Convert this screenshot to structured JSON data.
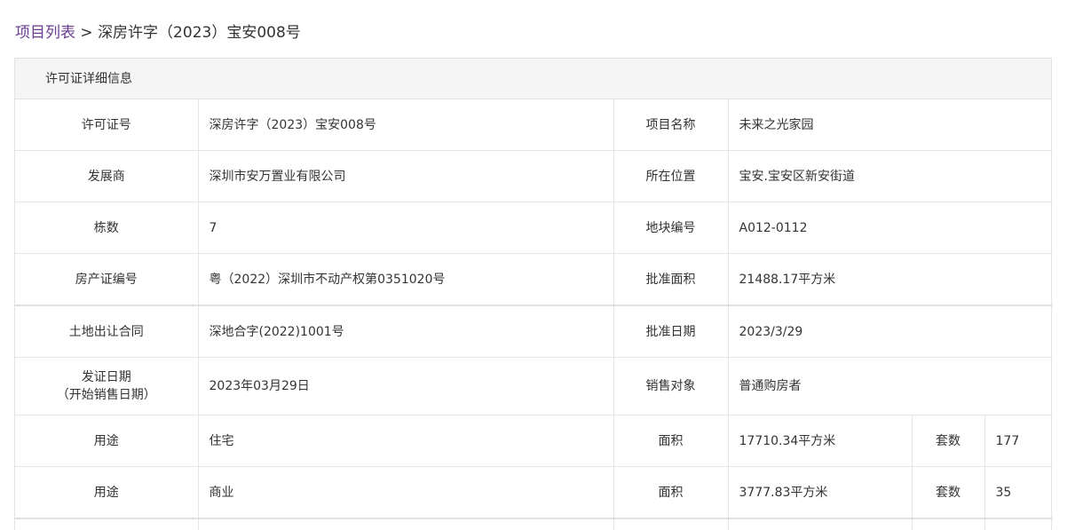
{
  "breadcrumb": {
    "link": "项目列表",
    "separator": ">",
    "current": "深房许字（2023）宝安008号"
  },
  "panel": {
    "title": "许可证详细信息"
  },
  "details": {
    "license_no_label": "许可证号",
    "license_no": "深房许字（2023）宝安008号",
    "project_name_label": "项目名称",
    "project_name": "未来之光家园",
    "developer_label": "发展商",
    "developer": "深圳市安万置业有限公司",
    "location_label": "所在位置",
    "location": "宝安.宝安区新安街道",
    "buildings_label": "栋数",
    "buildings": "7",
    "plot_no_label": "地块编号",
    "plot_no": "A012-0112",
    "property_cert_label": "房产证编号",
    "property_cert": "粤（2022）深圳市不动产权第0351020号",
    "approved_area_label": "批准面积",
    "approved_area": "21488.17平方米",
    "land_contract_label": "土地出让合同",
    "land_contract": "深地合字(2022)1001号",
    "approved_date_label": "批准日期",
    "approved_date": "2023/3/29",
    "issue_date_label_line1": "发证日期",
    "issue_date_label_line2": "（开始销售日期）",
    "issue_date": "2023年03月29日",
    "sales_target_label": "销售对象",
    "sales_target": "普通购房者"
  },
  "usage_rows": [
    {
      "usage_label": "用途",
      "usage": "住宅",
      "area_label": "面积",
      "area": "17710.34平方米",
      "units_label": "套数",
      "units": "177"
    },
    {
      "usage_label": "用途",
      "usage": "商业",
      "area_label": "面积",
      "area": "3777.83平方米",
      "units_label": "套数",
      "units": "35"
    }
  ],
  "colors": {
    "link": "#6a3d8f",
    "header_bg": "#f5f5f5",
    "border": "#e3e3e3",
    "text": "#333333"
  }
}
